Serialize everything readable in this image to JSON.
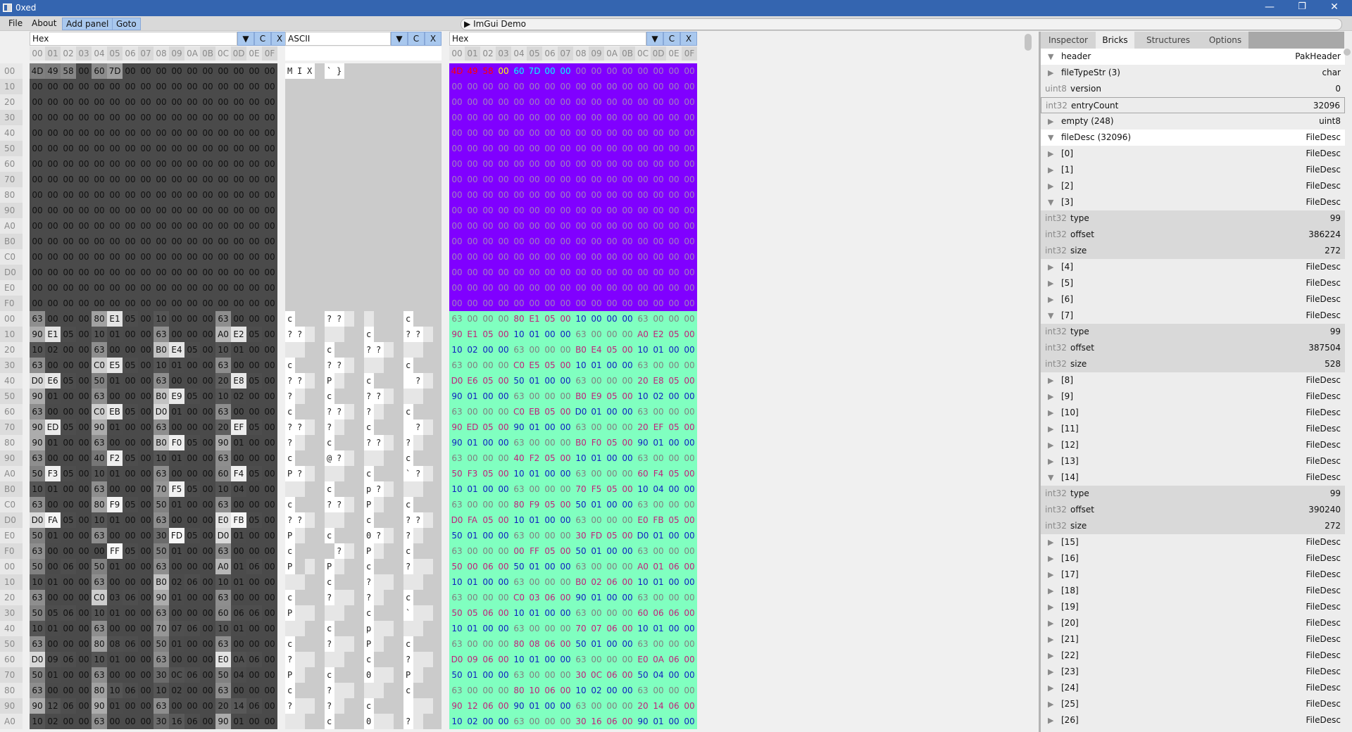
{
  "window": {
    "title": "0xed",
    "minimize_icon": "—",
    "restore_icon": "❐",
    "close_icon": "✕"
  },
  "menu": {
    "file": "File",
    "about": "About",
    "add_panel": "Add panel",
    "goto": "Goto",
    "imgui_demo": "ImGui Demo",
    "imgui_arrow": "▶"
  },
  "panels": [
    {
      "mode": "Hex",
      "dropdown_icon": "▼",
      "c_label": "C",
      "x_label": "X"
    },
    {
      "mode": "ASCII",
      "dropdown_icon": "▼",
      "c_label": "C",
      "x_label": "X"
    },
    {
      "mode": "Hex",
      "dropdown_icon": "▼",
      "c_label": "C",
      "x_label": "X"
    }
  ],
  "column_headers": [
    "00",
    "01",
    "02",
    "03",
    "04",
    "05",
    "06",
    "07",
    "08",
    "09",
    "0A",
    "0B",
    "0C",
    "0D",
    "0E",
    "0F"
  ],
  "row_labels": [
    "00",
    "10",
    "20",
    "30",
    "40",
    "50",
    "60",
    "70",
    "80",
    "90",
    "A0",
    "B0",
    "C0",
    "D0",
    "E0",
    "F0",
    "00",
    "10",
    "20",
    "30",
    "40",
    "50",
    "60",
    "70",
    "80",
    "90",
    "A0",
    "B0",
    "C0",
    "D0",
    "E0",
    "F0",
    "00",
    "10",
    "20",
    "30",
    "40",
    "50",
    "60",
    "70",
    "80",
    "90",
    "A0"
  ],
  "hex_rows": [
    "4D 49 58 00 60 7D 00 00 00 00 00 00 00 00 00 00",
    "00 00 00 00 00 00 00 00 00 00 00 00 00 00 00 00",
    "00 00 00 00 00 00 00 00 00 00 00 00 00 00 00 00",
    "00 00 00 00 00 00 00 00 00 00 00 00 00 00 00 00",
    "00 00 00 00 00 00 00 00 00 00 00 00 00 00 00 00",
    "00 00 00 00 00 00 00 00 00 00 00 00 00 00 00 00",
    "00 00 00 00 00 00 00 00 00 00 00 00 00 00 00 00",
    "00 00 00 00 00 00 00 00 00 00 00 00 00 00 00 00",
    "00 00 00 00 00 00 00 00 00 00 00 00 00 00 00 00",
    "00 00 00 00 00 00 00 00 00 00 00 00 00 00 00 00",
    "00 00 00 00 00 00 00 00 00 00 00 00 00 00 00 00",
    "00 00 00 00 00 00 00 00 00 00 00 00 00 00 00 00",
    "00 00 00 00 00 00 00 00 00 00 00 00 00 00 00 00",
    "00 00 00 00 00 00 00 00 00 00 00 00 00 00 00 00",
    "00 00 00 00 00 00 00 00 00 00 00 00 00 00 00 00",
    "00 00 00 00 00 00 00 00 00 00 00 00 00 00 00 00",
    "63 00 00 00 80 E1 05 00 10 00 00 00 63 00 00 00",
    "90 E1 05 00 10 01 00 00 63 00 00 00 A0 E2 05 00",
    "10 02 00 00 63 00 00 00 B0 E4 05 00 10 01 00 00",
    "63 00 00 00 C0 E5 05 00 10 01 00 00 63 00 00 00",
    "D0 E6 05 00 50 01 00 00 63 00 00 00 20 E8 05 00",
    "90 01 00 00 63 00 00 00 B0 E9 05 00 10 02 00 00",
    "63 00 00 00 C0 EB 05 00 D0 01 00 00 63 00 00 00",
    "90 ED 05 00 90 01 00 00 63 00 00 00 20 EF 05 00",
    "90 01 00 00 63 00 00 00 B0 F0 05 00 90 01 00 00",
    "63 00 00 00 40 F2 05 00 10 01 00 00 63 00 00 00",
    "50 F3 05 00 10 01 00 00 63 00 00 00 60 F4 05 00",
    "10 01 00 00 63 00 00 00 70 F5 05 00 10 04 00 00",
    "63 00 00 00 80 F9 05 00 50 01 00 00 63 00 00 00",
    "D0 FA 05 00 10 01 00 00 63 00 00 00 E0 FB 05 00",
    "50 01 00 00 63 00 00 00 30 FD 05 00 D0 01 00 00",
    "63 00 00 00 00 FF 05 00 50 01 00 00 63 00 00 00",
    "50 00 06 00 50 01 00 00 63 00 00 00 A0 01 06 00",
    "10 01 00 00 63 00 00 00 B0 02 06 00 10 01 00 00",
    "63 00 00 00 C0 03 06 00 90 01 00 00 63 00 00 00",
    "50 05 06 00 10 01 00 00 63 00 00 00 60 06 06 00",
    "10 01 00 00 63 00 00 00 70 07 06 00 10 01 00 00",
    "63 00 00 00 80 08 06 00 50 01 00 00 63 00 00 00",
    "D0 09 06 00 10 01 00 00 63 00 00 00 E0 0A 06 00",
    "50 01 00 00 63 00 00 00 30 0C 06 00 50 04 00 00",
    "63 00 00 00 80 10 06 00 10 02 00 00 63 00 00 00",
    "90 12 06 00 90 01 00 00 63 00 00 00 20 14 06 00",
    "10 02 00 00 63 00 00 00 30 16 06 00 90 01 00 00"
  ],
  "colors": {
    "header_bytes_bg": "#8000ff",
    "filedesc_bg": "#80ffc0",
    "magic_text": "#ff0000",
    "version_text": "#ffff00",
    "entrycount_text": "#00ffff",
    "empty_text": "#a080c0",
    "type_text": "#808080",
    "offset_text": "#c0207a",
    "size_text": "#1020c0",
    "titlebar": "#3465b0",
    "button": "#a9c8ee"
  },
  "inspector": {
    "tabs": [
      {
        "label": "Inspector",
        "active": false
      },
      {
        "label": "Bricks",
        "active": true
      },
      {
        "label": "Structures",
        "active": false
      },
      {
        "label": "Options",
        "active": false
      }
    ],
    "rows": [
      {
        "kind": "node",
        "expanded": true,
        "name": "header",
        "value": "PakHeader",
        "style": "hl"
      },
      {
        "kind": "node",
        "expanded": false,
        "name": "fileTypeStr (3)",
        "value": "char"
      },
      {
        "kind": "field",
        "type": "uint8",
        "name": "version",
        "value": "0",
        "style": "plain"
      },
      {
        "kind": "field",
        "type": "int32",
        "name": "entryCount",
        "value": "32096",
        "style": "boxed"
      },
      {
        "kind": "node",
        "expanded": false,
        "name": "empty (248)",
        "value": "uint8"
      },
      {
        "kind": "node",
        "expanded": true,
        "name": "fileDesc (32096)",
        "value": "FileDesc",
        "style": "hl"
      },
      {
        "kind": "node",
        "expanded": false,
        "name": "[0]",
        "value": "FileDesc"
      },
      {
        "kind": "node",
        "expanded": false,
        "name": "[1]",
        "value": "FileDesc"
      },
      {
        "kind": "node",
        "expanded": false,
        "name": "[2]",
        "value": "FileDesc"
      },
      {
        "kind": "node",
        "expanded": true,
        "name": "[3]",
        "value": "FileDesc"
      },
      {
        "kind": "field",
        "type": "int32",
        "name": "type",
        "value": "99"
      },
      {
        "kind": "field",
        "type": "int32",
        "name": "offset",
        "value": "386224"
      },
      {
        "kind": "field",
        "type": "int32",
        "name": "size",
        "value": "272"
      },
      {
        "kind": "node",
        "expanded": false,
        "name": "[4]",
        "value": "FileDesc"
      },
      {
        "kind": "node",
        "expanded": false,
        "name": "[5]",
        "value": "FileDesc"
      },
      {
        "kind": "node",
        "expanded": false,
        "name": "[6]",
        "value": "FileDesc"
      },
      {
        "kind": "node",
        "expanded": true,
        "name": "[7]",
        "value": "FileDesc"
      },
      {
        "kind": "field",
        "type": "int32",
        "name": "type",
        "value": "99"
      },
      {
        "kind": "field",
        "type": "int32",
        "name": "offset",
        "value": "387504"
      },
      {
        "kind": "field",
        "type": "int32",
        "name": "size",
        "value": "528"
      },
      {
        "kind": "node",
        "expanded": false,
        "name": "[8]",
        "value": "FileDesc"
      },
      {
        "kind": "node",
        "expanded": false,
        "name": "[9]",
        "value": "FileDesc"
      },
      {
        "kind": "node",
        "expanded": false,
        "name": "[10]",
        "value": "FileDesc"
      },
      {
        "kind": "node",
        "expanded": false,
        "name": "[11]",
        "value": "FileDesc"
      },
      {
        "kind": "node",
        "expanded": false,
        "name": "[12]",
        "value": "FileDesc"
      },
      {
        "kind": "node",
        "expanded": false,
        "name": "[13]",
        "value": "FileDesc"
      },
      {
        "kind": "node",
        "expanded": true,
        "name": "[14]",
        "value": "FileDesc"
      },
      {
        "kind": "field",
        "type": "int32",
        "name": "type",
        "value": "99"
      },
      {
        "kind": "field",
        "type": "int32",
        "name": "offset",
        "value": "390240"
      },
      {
        "kind": "field",
        "type": "int32",
        "name": "size",
        "value": "272"
      },
      {
        "kind": "node",
        "expanded": false,
        "name": "[15]",
        "value": "FileDesc"
      },
      {
        "kind": "node",
        "expanded": false,
        "name": "[16]",
        "value": "FileDesc"
      },
      {
        "kind": "node",
        "expanded": false,
        "name": "[17]",
        "value": "FileDesc"
      },
      {
        "kind": "node",
        "expanded": false,
        "name": "[18]",
        "value": "FileDesc"
      },
      {
        "kind": "node",
        "expanded": false,
        "name": "[19]",
        "value": "FileDesc"
      },
      {
        "kind": "node",
        "expanded": false,
        "name": "[20]",
        "value": "FileDesc"
      },
      {
        "kind": "node",
        "expanded": false,
        "name": "[21]",
        "value": "FileDesc"
      },
      {
        "kind": "node",
        "expanded": false,
        "name": "[22]",
        "value": "FileDesc"
      },
      {
        "kind": "node",
        "expanded": false,
        "name": "[23]",
        "value": "FileDesc"
      },
      {
        "kind": "node",
        "expanded": false,
        "name": "[24]",
        "value": "FileDesc"
      },
      {
        "kind": "node",
        "expanded": false,
        "name": "[25]",
        "value": "FileDesc"
      },
      {
        "kind": "node",
        "expanded": false,
        "name": "[26]",
        "value": "FileDesc"
      }
    ],
    "expanded_arrow": "▼",
    "collapsed_arrow": "▶"
  }
}
